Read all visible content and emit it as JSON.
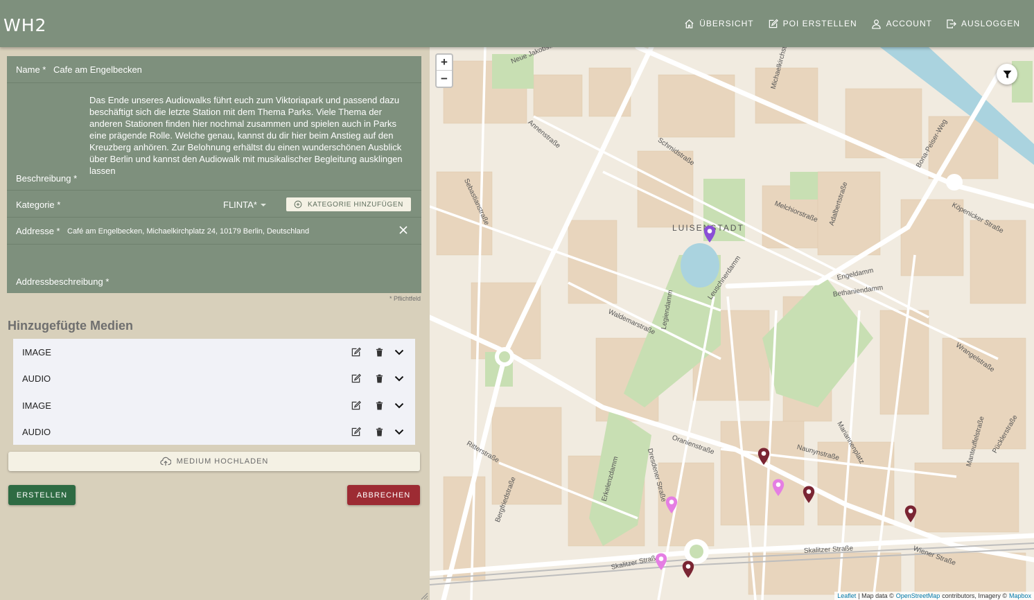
{
  "app": {
    "logo": "WH2"
  },
  "nav": [
    {
      "label": "ÜBERSICHT",
      "icon": "home-icon"
    },
    {
      "label": "POI ERSTELLEN",
      "icon": "edit-icon"
    },
    {
      "label": "ACCOUNT",
      "icon": "user-icon"
    },
    {
      "label": "AUSLOGGEN",
      "icon": "logout-icon"
    }
  ],
  "form": {
    "name_label": "Name *",
    "name_value": "Cafe am Engelbecken",
    "desc_label": "Beschreibung *",
    "desc_value": "Das Ende unseres Audiowalks führt euch zum Viktoriapark und passend dazu beschäftigt sich die letzte Station mit dem Thema Parks. Viele Thema der anderen Stationen finden hier nochmal zusammen und spielen auch in Parks eine prägende Rolle. Welche genau, kannst du dir hier beim Anstieg auf den Kreuzberg anhören. Zur Belohnung erhältst du einen wunderschönen Ausblick über Berlin und kannst den Audiowalk mit musikalischer Begleitung ausklingen lassen",
    "kategorie_label": "Kategorie *",
    "kategorie_value": "FLINTA*",
    "kategorie_button": "KATEGORIE HINZUFÜGEN",
    "addr_label": "Addresse *",
    "addr_value": "Café am Engelbecken, Michaelkirchplatz 24, 10179 Berlin, Deutschland",
    "addrdesc_label": "Addressbeschreibung *",
    "pflicht": "* Pflichtfeld"
  },
  "media": {
    "title": "Hinzugefügte Medien",
    "items": [
      {
        "label": "IMAGE"
      },
      {
        "label": "AUDIO"
      },
      {
        "label": "IMAGE"
      },
      {
        "label": "AUDIO"
      }
    ],
    "upload_label": "MEDIUM HOCHLADEN"
  },
  "actions": {
    "create": "ERSTELLEN",
    "cancel": "ABBRECHEN"
  },
  "map": {
    "zoom_in": "+",
    "zoom_out": "−",
    "district": "LUISENSTADT",
    "streets": [
      "Neue Jakobstraße",
      "Annenstraße",
      "Schmidstraße",
      "Sebastianstraße",
      "Melchiorstraße",
      "Adalbertstraße",
      "Engeldamm",
      "Köpenicker Straße",
      "Bona-Peiser-Weg",
      "Leuschnerdamm",
      "Bethaniendamm",
      "Waldemarstraße",
      "Legiendamm",
      "Oranienstraße",
      "Naunynstraße",
      "Mariannenplatz",
      "Wrangelstraße",
      "Manteuffelstraße",
      "Pücklerstraße",
      "Dresdener Straße",
      "Erkelenzdamm",
      "Ritterstraße",
      "Bergfriedstraße",
      "Skalitzer Straße",
      "Wiener Straße",
      "Michaelkirchstraße"
    ],
    "attribution": {
      "leaflet": "Leaflet",
      "text1": "| Map data ©",
      "osm": "OpenStreetMap",
      "text2": "contributors, Imagery ©",
      "mapbox": "Mapbox"
    },
    "colors": {
      "pin_purple": "#8a4fd6",
      "pin_pink": "#e57ee3",
      "pin_dark": "#7a2533",
      "water": "#aad3df",
      "park": "#c8dfb3"
    }
  }
}
